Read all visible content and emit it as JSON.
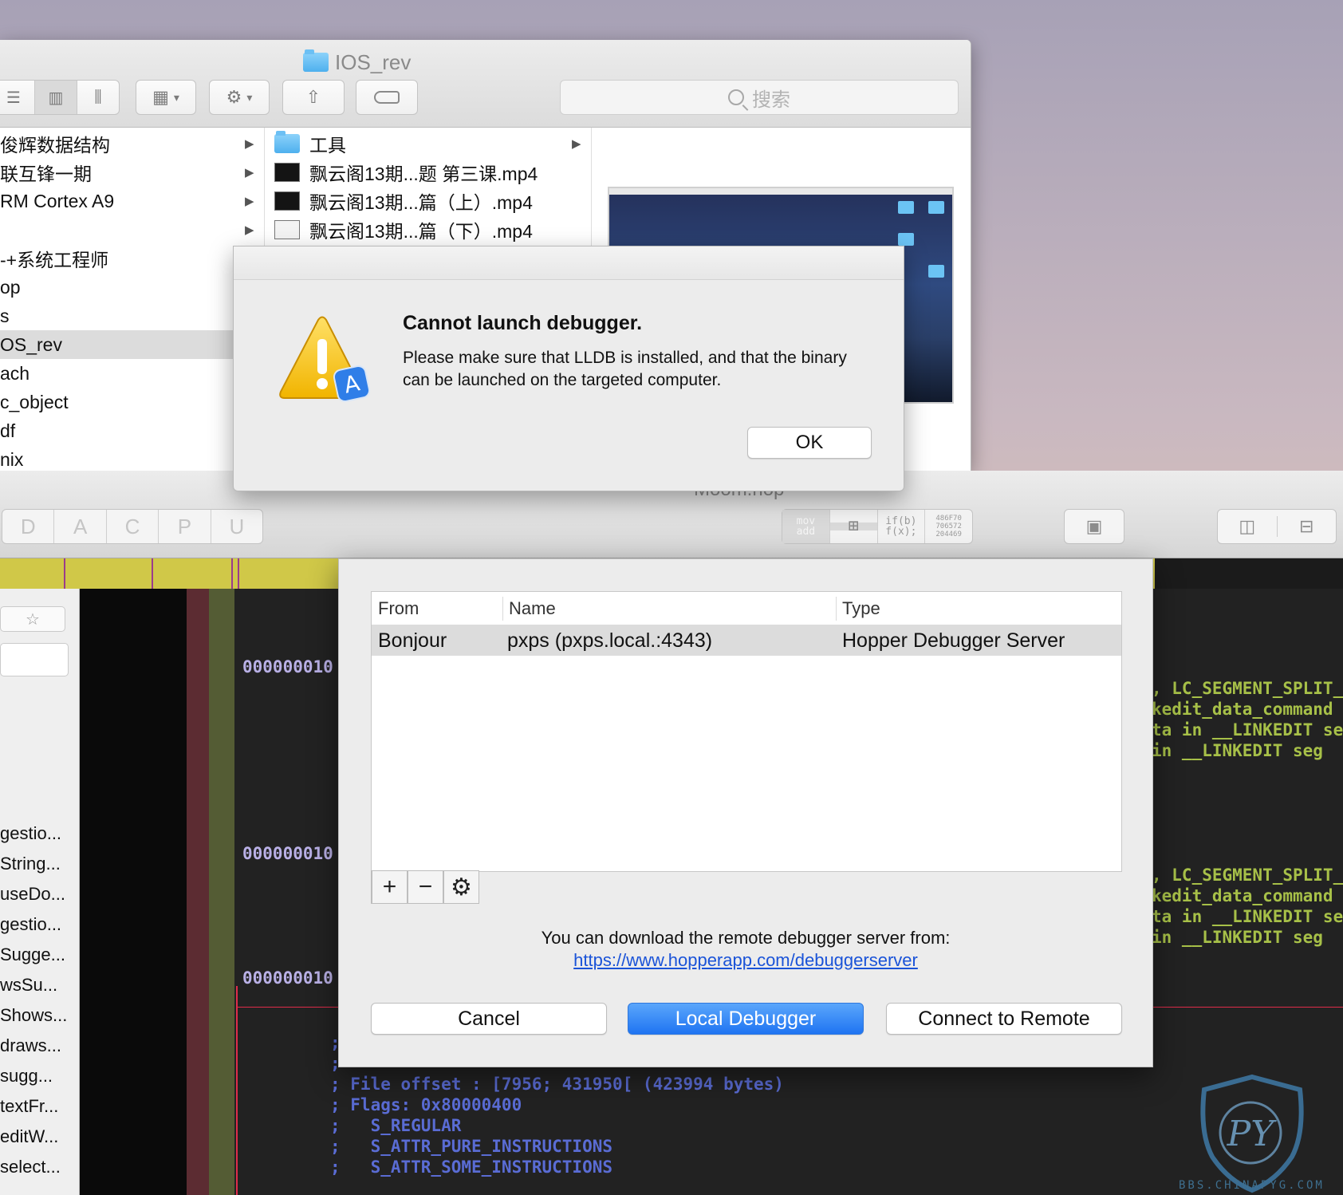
{
  "finder": {
    "title": "IOS_rev",
    "search_placeholder": "搜索",
    "column1": [
      {
        "label": "俊辉数据结构"
      },
      {
        "label": "联互锋一期"
      },
      {
        "label": "RM Cortex A9"
      },
      {
        "label": ""
      },
      {
        "label": "-+系统工程师"
      },
      {
        "label": "op"
      },
      {
        "label": "s"
      },
      {
        "label": "OS_rev"
      },
      {
        "label": "ach"
      },
      {
        "label": "c_object"
      },
      {
        "label": "df"
      },
      {
        "label": "nix"
      }
    ],
    "column2": [
      {
        "label": "工具",
        "kind": "folder-icon"
      },
      {
        "label": "飘云阁13期...题 第三课.mp4",
        "kind": "video-file-icon"
      },
      {
        "label": "飘云阁13期...篇（上）.mp4",
        "kind": "video-file-icon"
      },
      {
        "label": "飘云阁13期...篇（下）.mp4",
        "kind": "video-file-icon"
      }
    ]
  },
  "alert": {
    "title": "Cannot launch debugger.",
    "message": "Please make sure that LLDB is installed, and that the binary can be launched on the targeted computer.",
    "ok": "OK"
  },
  "hopper": {
    "title": "Moom.hop",
    "modes": [
      "D",
      "A",
      "C",
      "P",
      "U"
    ],
    "view_modes": [
      "mov\nadd",
      "",
      "if(b)\nf(x);",
      "486F70\n706572\n204469"
    ],
    "symbols": [
      "gestio...",
      "String...",
      "useDo...",
      "gestio...",
      "Sugge...",
      "wsSu...",
      "Shows...",
      "draws...",
      "sugg...",
      "textFr...",
      "editW...",
      "select..."
    ],
    "addresses": [
      "000000010",
      "000000010",
      "000000010"
    ],
    "comments_a": [
      ", LC_SEGMENT_SPLIT_",
      "kedit_data_command",
      "ta in __LINKEDIT se",
      " in __LINKEDIT seg"
    ],
    "comments_b": [
      ", LC_SEGMENT_SPLIT_",
      "kedit_data_command",
      "ta in __LINKEDIT se",
      " in __LINKEDIT seg"
    ],
    "section_lines": [
      ";",
      ";",
      "; File offset : [7956; 431950[ (423994 bytes)",
      "; Flags: 0x80000400",
      ";   S_REGULAR",
      ";   S_ATTR_PURE_INSTRUCTIONS",
      ";   S_ATTR_SOME_INSTRUCTIONS"
    ]
  },
  "debugger": {
    "columns": [
      "From",
      "Name",
      "Type"
    ],
    "rows": [
      {
        "from": "Bonjour",
        "name": "pxps (pxps.local.:4343)",
        "type": "Hopper Debugger Server"
      }
    ],
    "note": "You can download the remote debugger server from:",
    "link": "https://www.hopperapp.com/debuggerserver",
    "cancel": "Cancel",
    "local": "Local Debugger",
    "remote": "Connect to Remote"
  },
  "watermark": "BBS.CHINAPYG.COM",
  "colors": {
    "accent": "#1f74f2",
    "link": "#1a53d8",
    "nav_bar": "#d0c848",
    "comment": "#a7c048",
    "section": "#5a6cd4",
    "address": "#b9b0e6"
  }
}
